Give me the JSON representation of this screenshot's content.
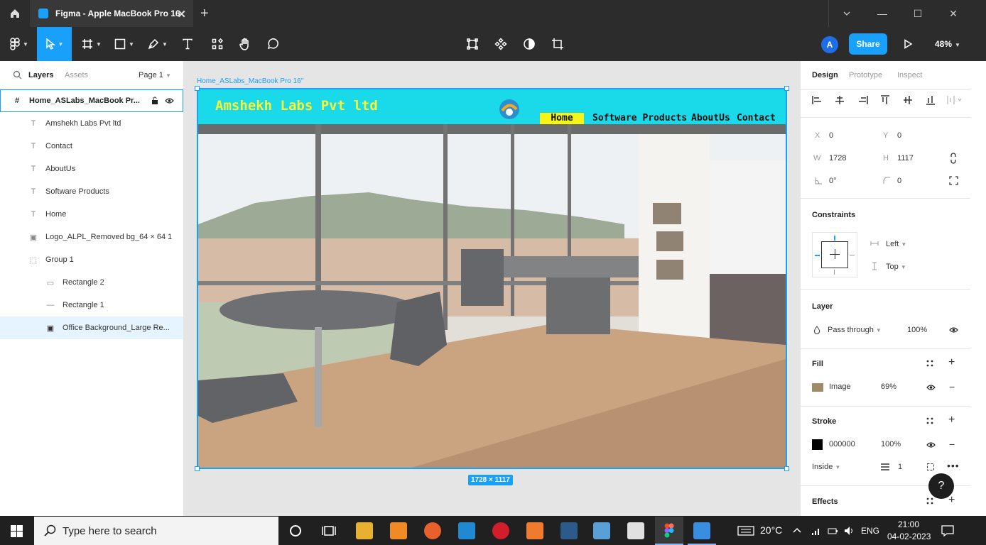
{
  "window": {
    "tab_title": "Figma - Apple MacBook Pro 16",
    "tab_close": "✕",
    "new_tab": "+",
    "min": "—",
    "max": "☐",
    "close": "✕"
  },
  "toolbar": {
    "avatar": "A",
    "share": "Share",
    "zoom": "48%"
  },
  "left_panel": {
    "tabs": {
      "layers": "Layers",
      "assets": "Assets",
      "page": "Page 1"
    },
    "layers": [
      {
        "icon": "#",
        "name": "Home_ASLabs_MacBook Pr..."
      },
      {
        "icon": "T",
        "name": "Amshekh Labs Pvt ltd"
      },
      {
        "icon": "T",
        "name": "Contact"
      },
      {
        "icon": "T",
        "name": "AboutUs"
      },
      {
        "icon": "T",
        "name": "Software Products"
      },
      {
        "icon": "T",
        "name": "Home"
      },
      {
        "icon": "▣",
        "name": "Logo_ALPL_Removed bg_64 × 64 1"
      },
      {
        "icon": "⬚",
        "name": "Group 1"
      },
      {
        "icon": "▭",
        "name": "Rectangle 2"
      },
      {
        "icon": "—",
        "name": "Rectangle 1"
      },
      {
        "icon": "▣",
        "name": "Office Background_Large Re..."
      }
    ]
  },
  "canvas": {
    "frame_label": "Home_ASLabs_MacBook Pro 16\"",
    "size_badge": "1728 × 1117",
    "site": {
      "title": "Amshekh Labs Pvt ltd",
      "nav": [
        "Home",
        "Software Products",
        "AboutUs",
        "Contact"
      ]
    }
  },
  "right_panel": {
    "tabs": {
      "design": "Design",
      "prototype": "Prototype",
      "inspect": "Inspect"
    },
    "x_label": "X",
    "x": "0",
    "y_label": "Y",
    "y": "0",
    "w_label": "W",
    "w": "1728",
    "h_label": "H",
    "h": "1117",
    "rotation": "0°",
    "radius": "0",
    "constraints": {
      "title": "Constraints",
      "horizontal": "Left",
      "vertical": "Top"
    },
    "layer": {
      "title": "Layer",
      "blend": "Pass through",
      "opacity": "100%"
    },
    "fill": {
      "title": "Fill",
      "type": "Image",
      "opacity": "69%"
    },
    "stroke": {
      "title": "Stroke",
      "color": "000000",
      "opacity": "100%",
      "position": "Inside",
      "weight": "1"
    },
    "effects": {
      "title": "Effects"
    },
    "help": "?"
  },
  "taskbar": {
    "search_placeholder": "Type here to search",
    "weather": "20°C",
    "lang": "ENG",
    "time": "21:00",
    "date": "04-02-2023"
  }
}
